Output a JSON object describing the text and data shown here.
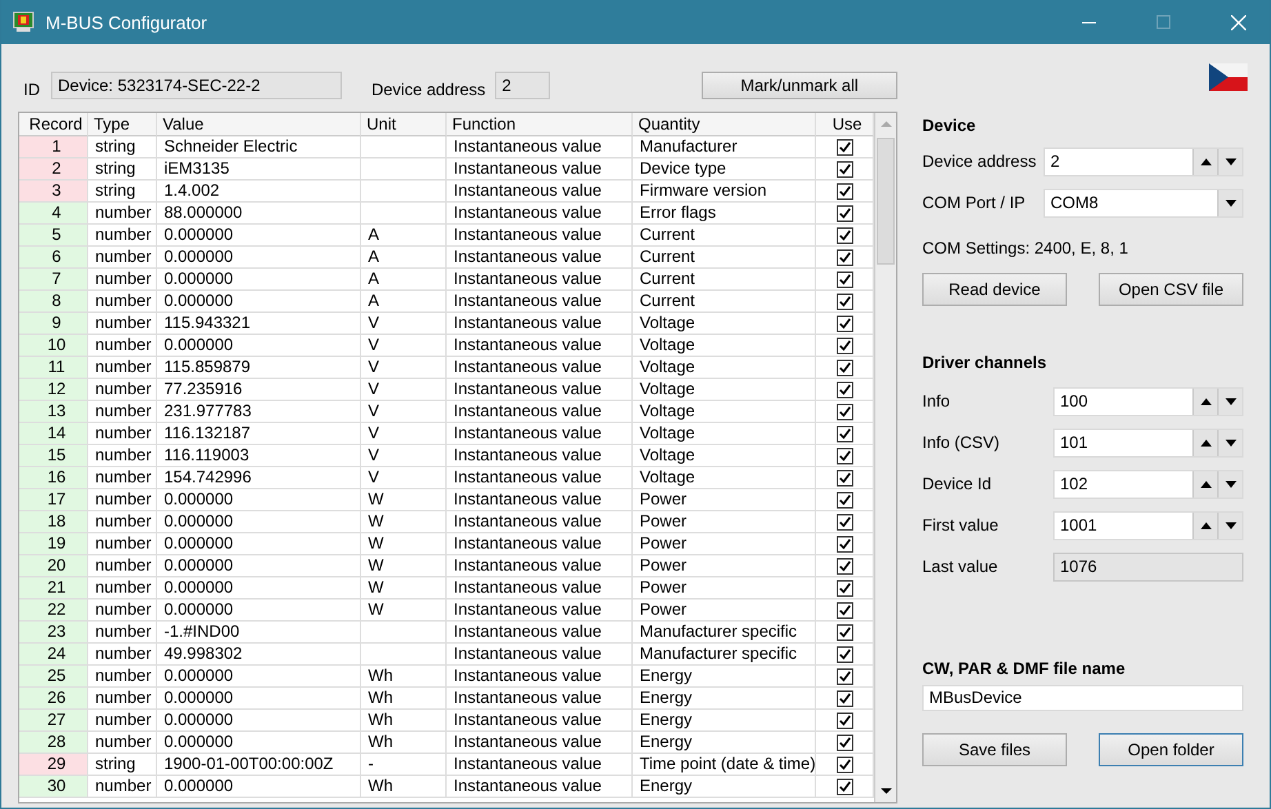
{
  "window": {
    "title": "M-BUS Configurator",
    "maximize_disabled": true
  },
  "header": {
    "id_label": "ID",
    "id_value": "Device: 5323174-SEC-22-2",
    "address_label": "Device address",
    "address_value": "2",
    "mark_button": "Mark/unmark all"
  },
  "table": {
    "columns": [
      "Record",
      "Type",
      "Value",
      "Unit",
      "Function",
      "Quantity",
      "Use"
    ],
    "rows": [
      {
        "record": "1",
        "type": "string",
        "value": "Schneider Electric",
        "unit": "",
        "function": "Instantaneous value",
        "quantity": "Manufacturer",
        "use": true,
        "color": "#fcdfe3"
      },
      {
        "record": "2",
        "type": "string",
        "value": "iEM3135",
        "unit": "",
        "function": "Instantaneous value",
        "quantity": "Device type",
        "use": true,
        "color": "#fcdfe3"
      },
      {
        "record": "3",
        "type": "string",
        "value": "1.4.002",
        "unit": "",
        "function": "Instantaneous value",
        "quantity": "Firmware version",
        "use": true,
        "color": "#fcdfe3"
      },
      {
        "record": "4",
        "type": "number",
        "value": "88.000000",
        "unit": "",
        "function": "Instantaneous value",
        "quantity": "Error flags",
        "use": true,
        "color": "#e1f8e1"
      },
      {
        "record": "5",
        "type": "number",
        "value": "0.000000",
        "unit": "A",
        "function": "Instantaneous value",
        "quantity": "Current",
        "use": true,
        "color": "#e1f8e1"
      },
      {
        "record": "6",
        "type": "number",
        "value": "0.000000",
        "unit": "A",
        "function": "Instantaneous value",
        "quantity": "Current",
        "use": true,
        "color": "#e1f8e1"
      },
      {
        "record": "7",
        "type": "number",
        "value": "0.000000",
        "unit": "A",
        "function": "Instantaneous value",
        "quantity": "Current",
        "use": true,
        "color": "#e1f8e1"
      },
      {
        "record": "8",
        "type": "number",
        "value": "0.000000",
        "unit": "A",
        "function": "Instantaneous value",
        "quantity": "Current",
        "use": true,
        "color": "#e1f8e1"
      },
      {
        "record": "9",
        "type": "number",
        "value": "115.943321",
        "unit": "V",
        "function": "Instantaneous value",
        "quantity": "Voltage",
        "use": true,
        "color": "#e1f8e1"
      },
      {
        "record": "10",
        "type": "number",
        "value": "0.000000",
        "unit": "V",
        "function": "Instantaneous value",
        "quantity": "Voltage",
        "use": true,
        "color": "#e1f8e1"
      },
      {
        "record": "11",
        "type": "number",
        "value": "115.859879",
        "unit": "V",
        "function": "Instantaneous value",
        "quantity": "Voltage",
        "use": true,
        "color": "#e1f8e1"
      },
      {
        "record": "12",
        "type": "number",
        "value": "77.235916",
        "unit": "V",
        "function": "Instantaneous value",
        "quantity": "Voltage",
        "use": true,
        "color": "#e1f8e1"
      },
      {
        "record": "13",
        "type": "number",
        "value": "231.977783",
        "unit": "V",
        "function": "Instantaneous value",
        "quantity": "Voltage",
        "use": true,
        "color": "#e1f8e1"
      },
      {
        "record": "14",
        "type": "number",
        "value": "116.132187",
        "unit": "V",
        "function": "Instantaneous value",
        "quantity": "Voltage",
        "use": true,
        "color": "#e1f8e1"
      },
      {
        "record": "15",
        "type": "number",
        "value": "116.119003",
        "unit": "V",
        "function": "Instantaneous value",
        "quantity": "Voltage",
        "use": true,
        "color": "#e1f8e1"
      },
      {
        "record": "16",
        "type": "number",
        "value": "154.742996",
        "unit": "V",
        "function": "Instantaneous value",
        "quantity": "Voltage",
        "use": true,
        "color": "#e1f8e1"
      },
      {
        "record": "17",
        "type": "number",
        "value": "0.000000",
        "unit": "W",
        "function": "Instantaneous value",
        "quantity": "Power",
        "use": true,
        "color": "#e1f8e1"
      },
      {
        "record": "18",
        "type": "number",
        "value": "0.000000",
        "unit": "W",
        "function": "Instantaneous value",
        "quantity": "Power",
        "use": true,
        "color": "#e1f8e1"
      },
      {
        "record": "19",
        "type": "number",
        "value": "0.000000",
        "unit": "W",
        "function": "Instantaneous value",
        "quantity": "Power",
        "use": true,
        "color": "#e1f8e1"
      },
      {
        "record": "20",
        "type": "number",
        "value": "0.000000",
        "unit": "W",
        "function": "Instantaneous value",
        "quantity": "Power",
        "use": true,
        "color": "#e1f8e1"
      },
      {
        "record": "21",
        "type": "number",
        "value": "0.000000",
        "unit": "W",
        "function": "Instantaneous value",
        "quantity": "Power",
        "use": true,
        "color": "#e1f8e1"
      },
      {
        "record": "22",
        "type": "number",
        "value": "0.000000",
        "unit": "W",
        "function": "Instantaneous value",
        "quantity": "Power",
        "use": true,
        "color": "#e1f8e1"
      },
      {
        "record": "23",
        "type": "number",
        "value": "-1.#IND00",
        "unit": "",
        "function": "Instantaneous value",
        "quantity": "Manufacturer specific",
        "use": true,
        "color": "#e1f8e1"
      },
      {
        "record": "24",
        "type": "number",
        "value": "49.998302",
        "unit": "",
        "function": "Instantaneous value",
        "quantity": "Manufacturer specific",
        "use": true,
        "color": "#e1f8e1"
      },
      {
        "record": "25",
        "type": "number",
        "value": "0.000000",
        "unit": "Wh",
        "function": "Instantaneous value",
        "quantity": "Energy",
        "use": true,
        "color": "#e1f8e1"
      },
      {
        "record": "26",
        "type": "number",
        "value": "0.000000",
        "unit": "Wh",
        "function": "Instantaneous value",
        "quantity": "Energy",
        "use": true,
        "color": "#e1f8e1"
      },
      {
        "record": "27",
        "type": "number",
        "value": "0.000000",
        "unit": "Wh",
        "function": "Instantaneous value",
        "quantity": "Energy",
        "use": true,
        "color": "#e1f8e1"
      },
      {
        "record": "28",
        "type": "number",
        "value": "0.000000",
        "unit": "Wh",
        "function": "Instantaneous value",
        "quantity": "Energy",
        "use": true,
        "color": "#e1f8e1"
      },
      {
        "record": "29",
        "type": "string",
        "value": "1900-01-00T00:00:00Z",
        "unit": "-",
        "function": "Instantaneous value",
        "quantity": "Time point (date & time)",
        "use": true,
        "color": "#fcdfe3"
      },
      {
        "record": "30",
        "type": "number",
        "value": "0.000000",
        "unit": "Wh",
        "function": "Instantaneous value",
        "quantity": "Energy",
        "use": true,
        "color": "#e1f8e1"
      }
    ]
  },
  "device": {
    "title": "Device",
    "address_label": "Device address",
    "address_value": "2",
    "port_label": "COM Port / IP",
    "port_value": "COM8",
    "settings": "COM Settings: 2400, E, 8, 1",
    "buttons": [
      {
        "label": "Read device",
        "focused": false
      },
      {
        "label": "Open CSV file",
        "focused": false
      }
    ]
  },
  "channels": {
    "title": "Driver channels",
    "items": [
      {
        "label": "Info",
        "value": "100",
        "kind": "spin"
      },
      {
        "label": "Info (CSV)",
        "value": "101",
        "kind": "spin"
      },
      {
        "label": "Device Id",
        "value": "102",
        "kind": "spin"
      },
      {
        "label": "First value",
        "value": "1001",
        "kind": "spin"
      },
      {
        "label": "Last value",
        "value": "1076",
        "kind": "readonly"
      }
    ]
  },
  "files": {
    "title": "CW, PAR & DMF file name",
    "value": "MBusDevice",
    "buttons": [
      {
        "label": "Save files",
        "focused": false
      },
      {
        "label": "Open folder",
        "focused": true
      }
    ]
  }
}
